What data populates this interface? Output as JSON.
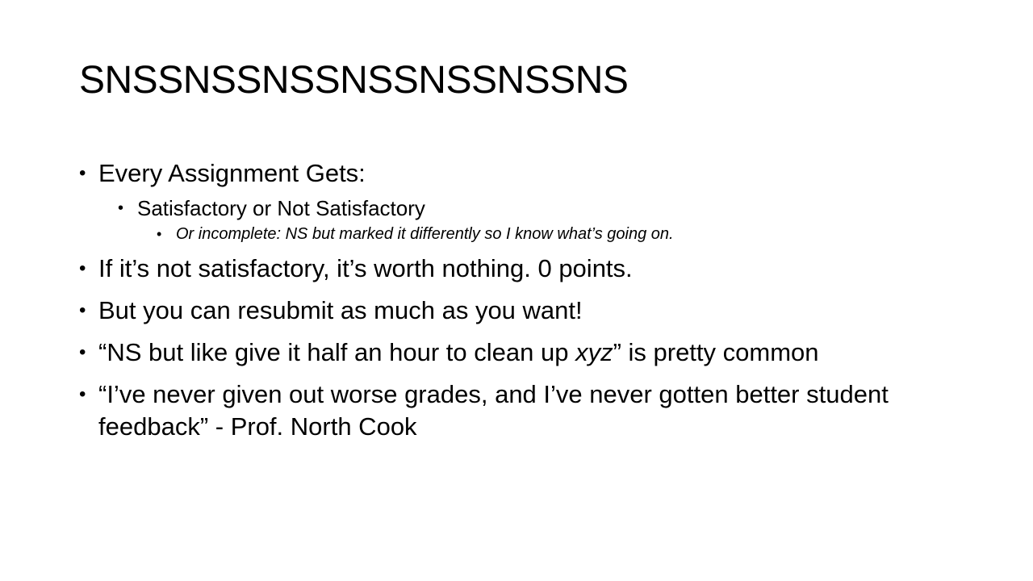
{
  "slide": {
    "title": "SNSSNSSNSSNSSNSSNSSNS",
    "bullets": {
      "b1": "Every Assignment Gets:",
      "b1_sub": "Satisfactory or Not Satisfactory",
      "b1_subsub": "Or incomplete: NS but marked it differently so I know what’s going on.",
      "b2": "If it’s not satisfactory, it’s worth nothing. 0 points.",
      "b3": "But you can resubmit as much as you want!",
      "b4_pre": "“NS but like give it half an hour to clean up ",
      "b4_em": "xyz",
      "b4_post": "” is pretty common",
      "b5": "“I’ve never given out worse grades, and I’ve never gotten better student feedback” - Prof. North Cook"
    },
    "bullet_glyph": "•"
  }
}
